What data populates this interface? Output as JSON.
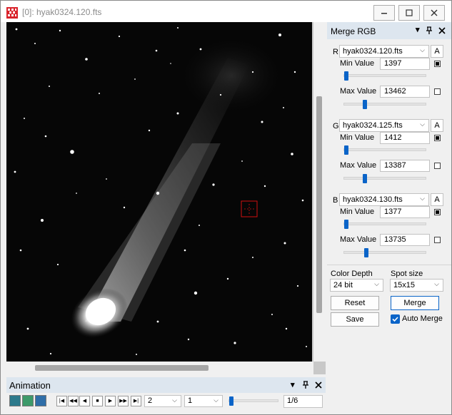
{
  "window": {
    "title": "[0]: hyak0324.120.fts"
  },
  "merge_panel": {
    "title": "Merge RGB",
    "channels": [
      {
        "letter": "R",
        "file": "hyak0324.120.fts",
        "auto_label": "A",
        "min_label": "Min Value",
        "min_value": "1397",
        "min_checked": true,
        "max_label": "Max Value",
        "max_value": "13462",
        "max_checked": false
      },
      {
        "letter": "G",
        "file": "hyak0324.125.fts",
        "auto_label": "A",
        "min_label": "Min Value",
        "min_value": "1412",
        "min_checked": true,
        "max_label": "Max Value",
        "max_value": "13387",
        "max_checked": false
      },
      {
        "letter": "B",
        "file": "hyak0324.130.fts",
        "auto_label": "A",
        "min_label": "Min Value",
        "min_value": "1377",
        "min_checked": true,
        "max_label": "Max Value",
        "max_value": "13735",
        "max_checked": false
      }
    ],
    "color_depth_label": "Color Depth",
    "color_depth_value": "24 bit",
    "spot_size_label": "Spot size",
    "spot_size_value": "15x15",
    "reset_label": "Reset",
    "merge_label": "Merge",
    "save_label": "Save",
    "auto_merge_label": "Auto Merge"
  },
  "animation": {
    "title": "Animation",
    "dropdown1": "2",
    "dropdown2": "1",
    "frame": "1/6"
  },
  "colors": {
    "accent": "#0a64c8",
    "header": "#dde6ef",
    "marker": "#d01010"
  }
}
